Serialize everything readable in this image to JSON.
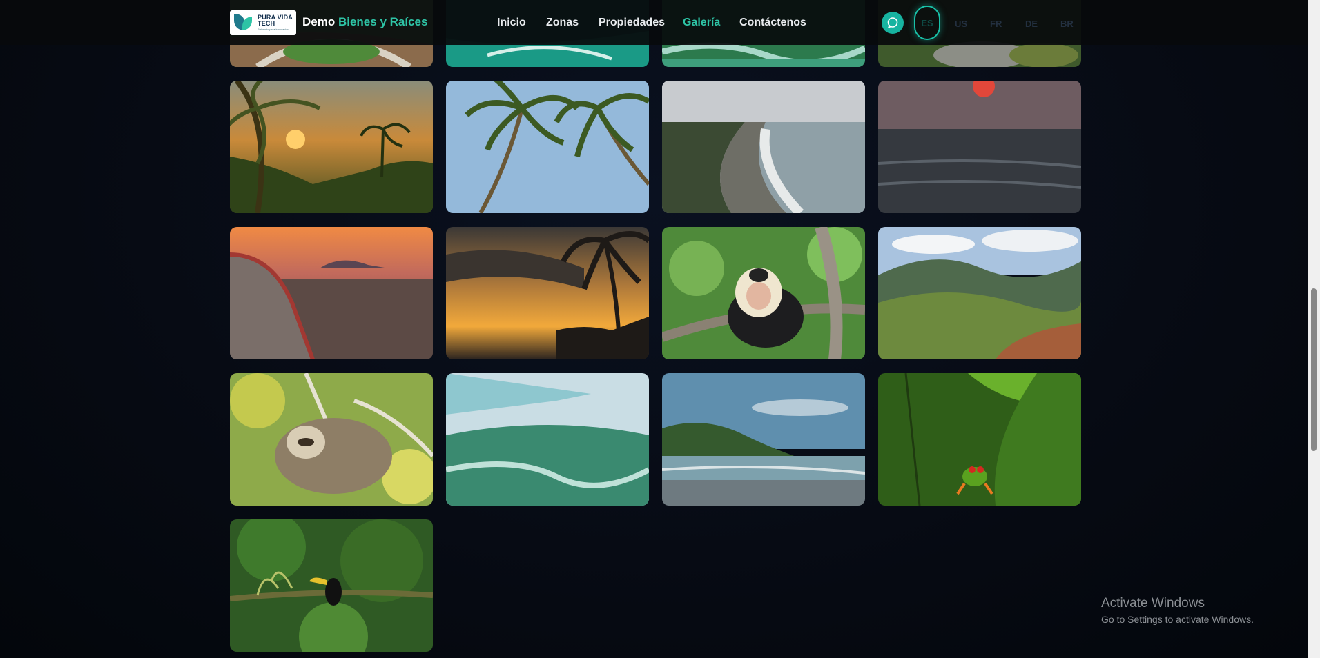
{
  "header": {
    "logo": {
      "line1": "PURA VIDA",
      "line2": "TECH",
      "tagline": "Futuristic para innovación"
    },
    "brand_name": "Demo",
    "brand_accent": "Bienes y Raíces",
    "nav": [
      {
        "label": "Inicio",
        "active": false
      },
      {
        "label": "Zonas",
        "active": false
      },
      {
        "label": "Propiedades",
        "active": false
      },
      {
        "label": "Galería",
        "active": true
      },
      {
        "label": "Contáctenos",
        "active": false
      }
    ],
    "chat_icon": "chat-bubble-icon",
    "languages": [
      "ES",
      "US",
      "FR",
      "DE",
      "BR"
    ],
    "active_language": "ES"
  },
  "gallery": {
    "images": [
      {
        "subject": "road"
      },
      {
        "subject": "aerial-coast"
      },
      {
        "subject": "aerial-river"
      },
      {
        "subject": "jungle-river"
      },
      {
        "subject": "palm-sunset"
      },
      {
        "subject": "palm-sky"
      },
      {
        "subject": "coastline"
      },
      {
        "subject": "ocean-sunset"
      },
      {
        "subject": "beach-boat"
      },
      {
        "subject": "palm-silhouette"
      },
      {
        "subject": "capuchin-monkey"
      },
      {
        "subject": "mountains"
      },
      {
        "subject": "sloth"
      },
      {
        "subject": "aerial-wing"
      },
      {
        "subject": "beach-island"
      },
      {
        "subject": "tree-frog"
      },
      {
        "subject": "toucan"
      }
    ]
  },
  "system": {
    "activate_title": "Activate Windows",
    "activate_sub": "Go to Settings to activate Windows."
  },
  "colors": {
    "accent": "#2ec4a6",
    "background": "#070b14",
    "header": "#080a0c"
  }
}
